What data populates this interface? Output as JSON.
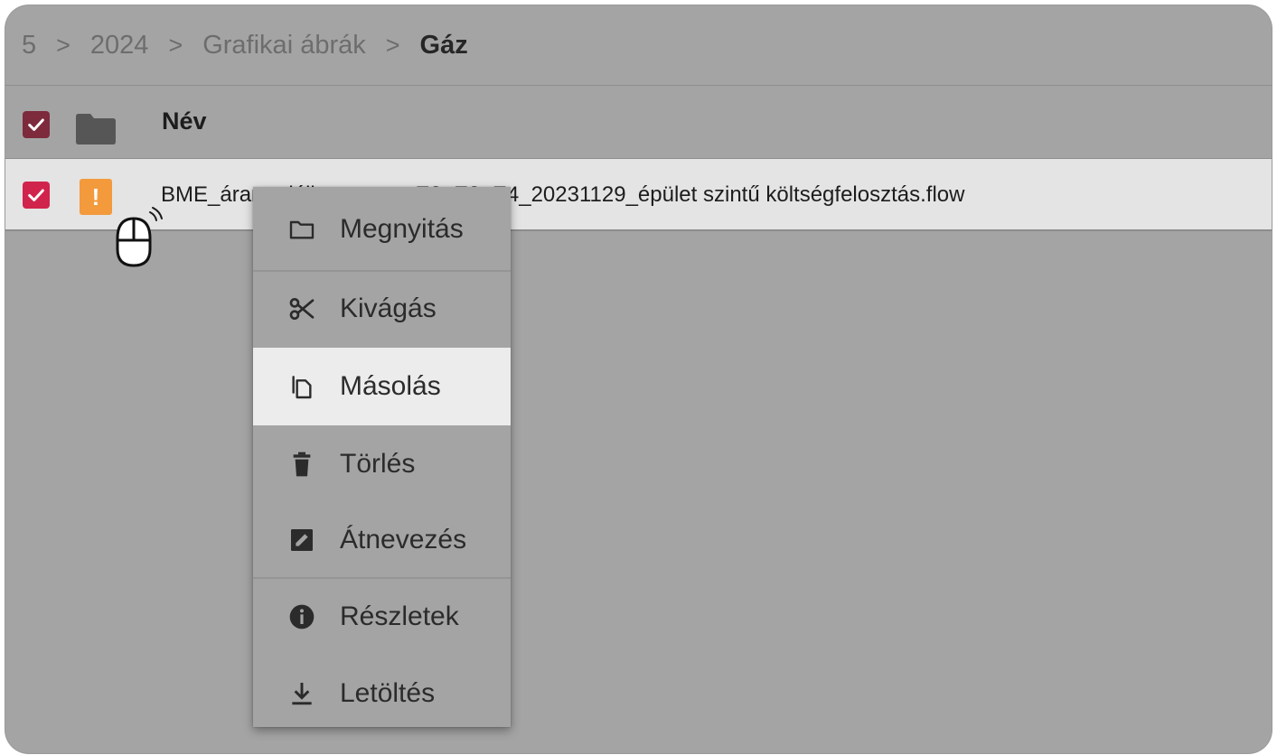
{
  "breadcrumb": {
    "items": [
      "5",
      "2024",
      "Grafikai ábrák",
      "Gáz"
    ],
    "separator": ">"
  },
  "table": {
    "header": {
      "name_label": "Név",
      "select_all_checked": true
    },
    "rows": [
      {
        "name": "BME_áram_déli_campus_E2_E3_E4_20231129_épület szintű költségfelosztás.flow",
        "checked": true,
        "icon": "warning-file-icon",
        "icon_glyph": "!"
      }
    ]
  },
  "context_menu": {
    "items": [
      {
        "label": "Megnyitás",
        "icon": "folder-open-icon"
      },
      {
        "label": "Kivágás",
        "icon": "scissors-icon"
      },
      {
        "label": "Másolás",
        "icon": "copy-icon",
        "highlighted": true
      },
      {
        "label": "Törlés",
        "icon": "trash-icon"
      },
      {
        "label": "Átnevezés",
        "icon": "rename-icon"
      },
      {
        "label": "Részletek",
        "icon": "info-icon"
      },
      {
        "label": "Letöltés",
        "icon": "download-icon"
      }
    ]
  },
  "colors": {
    "background": "#a4a4a4",
    "header_checkbox": "#7d2a3d",
    "row_checkbox": "#d1244c",
    "file_icon": "#f39a3d",
    "selected_row": "#e4e4e4",
    "menu_highlight": "#ececec"
  }
}
